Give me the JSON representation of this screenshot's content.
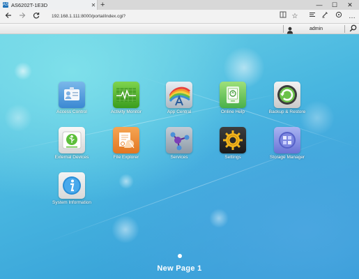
{
  "browser": {
    "tab_title": "AS6202T-1E3D",
    "tab_favicon": "AS",
    "tab_close": "✕",
    "new_tab": "+",
    "address": "192.168.1.111:8000/portal/index.cgi?",
    "icons": [
      "back-icon",
      "forward-icon",
      "refresh-icon",
      "reading-view-icon",
      "favorite-icon",
      "hub-icon",
      "web-note-icon",
      "share-icon"
    ],
    "window_controls": [
      "—",
      "☐",
      "✕"
    ]
  },
  "nasbar": {
    "user_label": "admin",
    "icons": [
      "user-icon",
      "search-icon"
    ]
  },
  "apps": [
    {
      "label": "Access Control",
      "icon": "access-control-icon"
    },
    {
      "label": "Activity Monitor",
      "icon": "activity-monitor-icon"
    },
    {
      "label": "App Central",
      "icon": "app-central-icon"
    },
    {
      "label": "Online Help",
      "icon": "online-help-icon"
    },
    {
      "label": "Backup & Restore",
      "icon": "backup-restore-icon"
    },
    {
      "label": "External Devices",
      "icon": "external-devices-icon"
    },
    {
      "label": "File Explorer",
      "icon": "file-explorer-icon"
    },
    {
      "label": "Services",
      "icon": "services-icon"
    },
    {
      "label": "Settings",
      "icon": "settings-icon"
    },
    {
      "label": "Storage Manager",
      "icon": "storage-manager-icon"
    },
    {
      "label": "System Information",
      "icon": "system-information-icon"
    }
  ],
  "pager": {
    "label": "New Page 1"
  },
  "colors": {
    "desktop_top": "#6fd3e6",
    "desktop_bottom": "#2e96d4"
  }
}
